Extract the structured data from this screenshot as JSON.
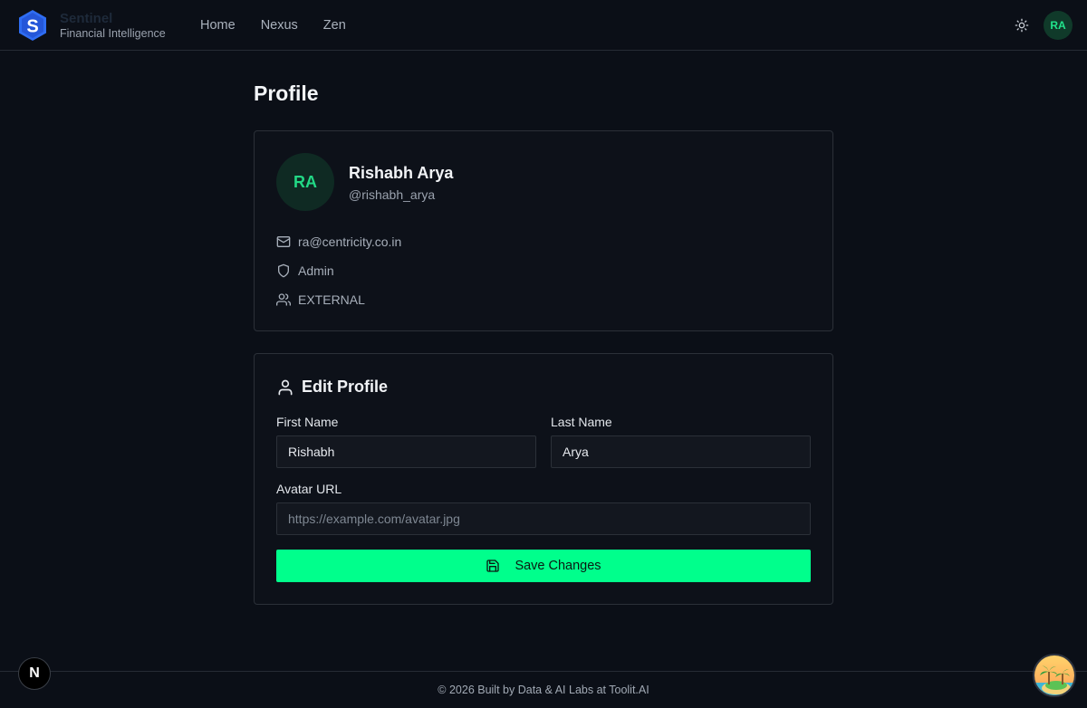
{
  "header": {
    "brand_name": "Sentinel",
    "brand_subtitle": "Financial Intelligence",
    "logo_letter": "S",
    "nav": [
      {
        "label": "Home"
      },
      {
        "label": "Nexus"
      },
      {
        "label": "Zen"
      }
    ],
    "theme_icon": "sun-icon",
    "user_initials": "RA"
  },
  "page": {
    "title": "Profile"
  },
  "profile": {
    "initials": "RA",
    "name": "Rishabh Arya",
    "handle": "@rishabh_arya",
    "email": "ra@centricity.co.in",
    "role": "Admin",
    "group": "EXTERNAL",
    "icons": [
      "mail-icon",
      "shield-icon",
      "users-icon"
    ]
  },
  "edit": {
    "title": "Edit Profile",
    "first_name_label": "First Name",
    "first_name_value": "Rishabh",
    "last_name_label": "Last Name",
    "last_name_value": "Arya",
    "avatar_label": "Avatar URL",
    "avatar_placeholder": "https://example.com/avatar.jpg",
    "save_label": "Save Changes"
  },
  "footer": {
    "text": "© 2026 Built by Data & AI Labs at Toolit.AI",
    "next_badge": "N"
  },
  "colors": {
    "background": "#0b0f17",
    "accent": "#00ff8c",
    "avatar_text": "#22d885",
    "logo": "#2f6df2"
  }
}
